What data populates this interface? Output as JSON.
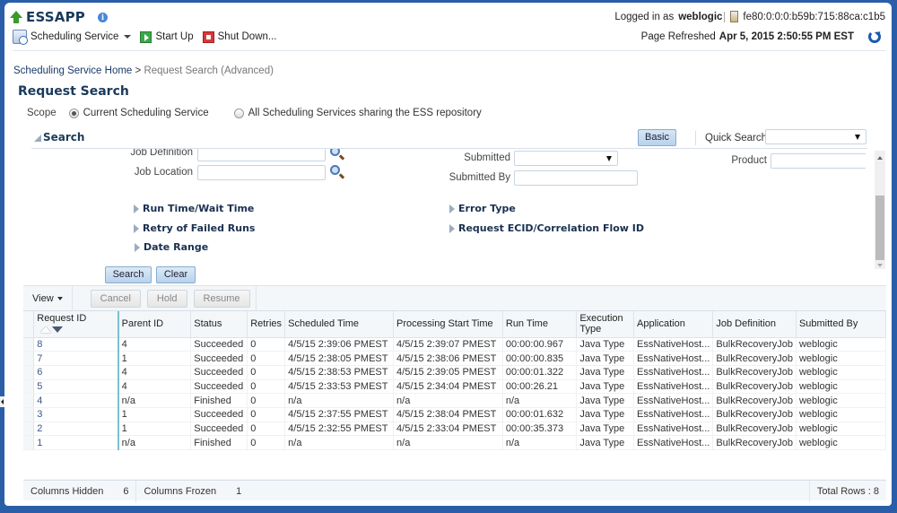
{
  "app": {
    "title": "ESSAPP",
    "info_icon": "info-icon"
  },
  "toolbar": {
    "scheduling_service": "Scheduling Service",
    "start_up": "Start Up",
    "shut_down": "Shut Down..."
  },
  "session": {
    "logged_in_label": "Logged in as",
    "user": "weblogic",
    "host": "fe80:0:0:0:b59b:715:88ca:c1b5",
    "refreshed_label": "Page Refreshed",
    "refreshed_value": "Apr 5, 2015 2:50:55 PM EST"
  },
  "breadcrumb": {
    "home": "Scheduling Service Home",
    "separator": ">",
    "current": "Request Search (Advanced)"
  },
  "page_title": "Request Search",
  "scope": {
    "label": "Scope",
    "options": [
      {
        "label": "Current Scheduling Service",
        "selected": true
      },
      {
        "label": "All Scheduling Services sharing the ESS repository",
        "selected": false
      }
    ]
  },
  "search": {
    "header": "Search",
    "basic_button": "Basic",
    "quick_search_label": "Quick Search",
    "quick_search_value": "",
    "fields": {
      "job_definition": {
        "label": "Job Definition",
        "value": ""
      },
      "job_location": {
        "label": "Job Location",
        "value": ""
      },
      "submitted": {
        "label": "Submitted",
        "value": ""
      },
      "submitted_by": {
        "label": "Submitted By",
        "value": ""
      },
      "product": {
        "label": "Product",
        "value": ""
      }
    },
    "disclosures_left": [
      "Run Time/Wait Time",
      "Retry of Failed Runs",
      "Date Range"
    ],
    "disclosures_right": [
      "Error Type",
      "Request ECID/Correlation Flow ID"
    ],
    "search_button": "Search",
    "clear_button": "Clear"
  },
  "results": {
    "view_menu": "View",
    "actions": [
      "Cancel",
      "Hold",
      "Resume"
    ],
    "columns": [
      "Request ID",
      "Parent ID",
      "Status",
      "Retries",
      "Scheduled Time",
      "Processing Start Time",
      "Run Time",
      "Execution Type",
      "Application",
      "Job Definition",
      "Submitted By"
    ],
    "sort": {
      "column": "Request ID",
      "direction": "descending"
    },
    "rows": [
      [
        "8",
        "4",
        "Succeeded",
        "0",
        "4/5/15 2:39:06 PMEST",
        "4/5/15 2:39:07 PMEST",
        "00:00:00.967",
        "Java Type",
        "EssNativeHost...",
        "BulkRecoveryJob",
        "weblogic"
      ],
      [
        "7",
        "1",
        "Succeeded",
        "0",
        "4/5/15 2:38:05 PMEST",
        "4/5/15 2:38:06 PMEST",
        "00:00:00.835",
        "Java Type",
        "EssNativeHost...",
        "BulkRecoveryJob",
        "weblogic"
      ],
      [
        "6",
        "4",
        "Succeeded",
        "0",
        "4/5/15 2:38:53 PMEST",
        "4/5/15 2:39:05 PMEST",
        "00:00:01.322",
        "Java Type",
        "EssNativeHost...",
        "BulkRecoveryJob",
        "weblogic"
      ],
      [
        "5",
        "4",
        "Succeeded",
        "0",
        "4/5/15 2:33:53 PMEST",
        "4/5/15 2:34:04 PMEST",
        "00:00:26.21",
        "Java Type",
        "EssNativeHost...",
        "BulkRecoveryJob",
        "weblogic"
      ],
      [
        "4",
        "n/a",
        "Finished",
        "0",
        "n/a",
        "n/a",
        "n/a",
        "Java Type",
        "EssNativeHost...",
        "BulkRecoveryJob",
        "weblogic"
      ],
      [
        "3",
        "1",
        "Succeeded",
        "0",
        "4/5/15 2:37:55 PMEST",
        "4/5/15 2:38:04 PMEST",
        "00:00:01.632",
        "Java Type",
        "EssNativeHost...",
        "BulkRecoveryJob",
        "weblogic"
      ],
      [
        "2",
        "1",
        "Succeeded",
        "0",
        "4/5/15 2:32:55 PMEST",
        "4/5/15 2:33:04 PMEST",
        "00:00:35.373",
        "Java Type",
        "EssNativeHost...",
        "BulkRecoveryJob",
        "weblogic"
      ],
      [
        "1",
        "n/a",
        "Finished",
        "0",
        "n/a",
        "n/a",
        "n/a",
        "Java Type",
        "EssNativeHost...",
        "BulkRecoveryJob",
        "weblogic"
      ]
    ],
    "status_bar": {
      "columns_hidden_label": "Columns Hidden",
      "columns_hidden_value": "6",
      "columns_frozen_label": "Columns Frozen",
      "columns_frozen_value": "1",
      "total_rows": "Total Rows : 8"
    }
  },
  "colors": {
    "frame": "#2a5ea8",
    "title": "#1a3a5a",
    "button_bg": "#b8d2ec",
    "frozen_divider": "#7ac0d0"
  }
}
